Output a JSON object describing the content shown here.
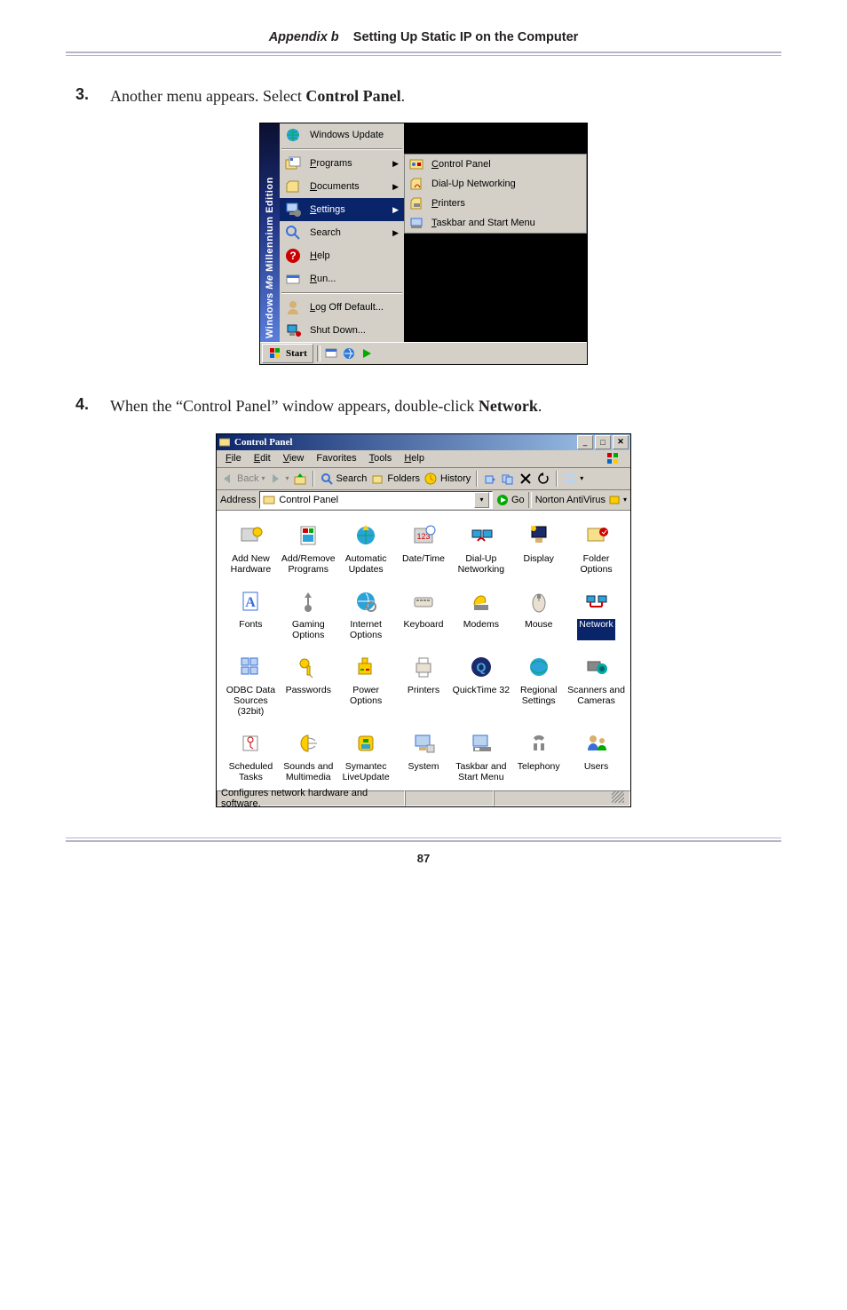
{
  "header": {
    "appendix": "Appendix b",
    "title": "Setting Up Static IP on the Computer"
  },
  "steps": {
    "s3": {
      "num": "3.",
      "text_before": "Another menu appears. Select ",
      "bold": "Control Panel",
      "text_after": "."
    },
    "s4": {
      "num": "4.",
      "text_before": "When the “Control Panel” window appears, double-click ",
      "bold": "Network",
      "text_after": "."
    }
  },
  "startmenu": {
    "sidestrip_a": "Windows",
    "sidestrip_b": "Me",
    "sidestrip_c": " Millennium Edition",
    "items": [
      {
        "label": "Windows Update",
        "has_arrow": false
      },
      {
        "label": "Programs",
        "has_arrow": true
      },
      {
        "label": "Documents",
        "has_arrow": true
      },
      {
        "label": "Settings",
        "has_arrow": true,
        "hover": true
      },
      {
        "label": "Search",
        "has_arrow": true
      },
      {
        "label": "Help",
        "has_arrow": false
      },
      {
        "label": "Run...",
        "has_arrow": false
      },
      {
        "label": "Log Off Default...",
        "has_arrow": false
      },
      {
        "label": "Shut Down...",
        "has_arrow": false
      }
    ],
    "submenu": [
      {
        "label": "Control Panel"
      },
      {
        "label": "Dial-Up Networking"
      },
      {
        "label": "Printers"
      },
      {
        "label": "Taskbar and Start Menu"
      }
    ],
    "taskbar": {
      "start": "Start"
    }
  },
  "cpwin": {
    "title": "Control Panel",
    "menus": [
      "File",
      "Edit",
      "View",
      "Favorites",
      "Tools",
      "Help"
    ],
    "toolbar": {
      "back": "Back",
      "search": "Search",
      "folders": "Folders",
      "history": "History"
    },
    "address": {
      "label": "Address",
      "value": "Control Panel",
      "go": "Go",
      "norton": "Norton AntiVirus"
    },
    "items": [
      "Add New Hardware",
      "Add/Remove Programs",
      "Automatic Updates",
      "Date/Time",
      "Dial-Up Networking",
      "Display",
      "Folder Options",
      "Fonts",
      "Gaming Options",
      "Internet Options",
      "Keyboard",
      "Modems",
      "Mouse",
      "Network",
      "ODBC Data Sources (32bit)",
      "Passwords",
      "Power Options",
      "Printers",
      "QuickTime 32",
      "Regional Settings",
      "Scanners and Cameras",
      "Scheduled Tasks",
      "Sounds and Multimedia",
      "Symantec LiveUpdate",
      "System",
      "Taskbar and Start Menu",
      "Telephony",
      "Users"
    ],
    "selected_index": 13,
    "status": "Configures network hardware and software."
  },
  "footer": {
    "page": "87"
  }
}
